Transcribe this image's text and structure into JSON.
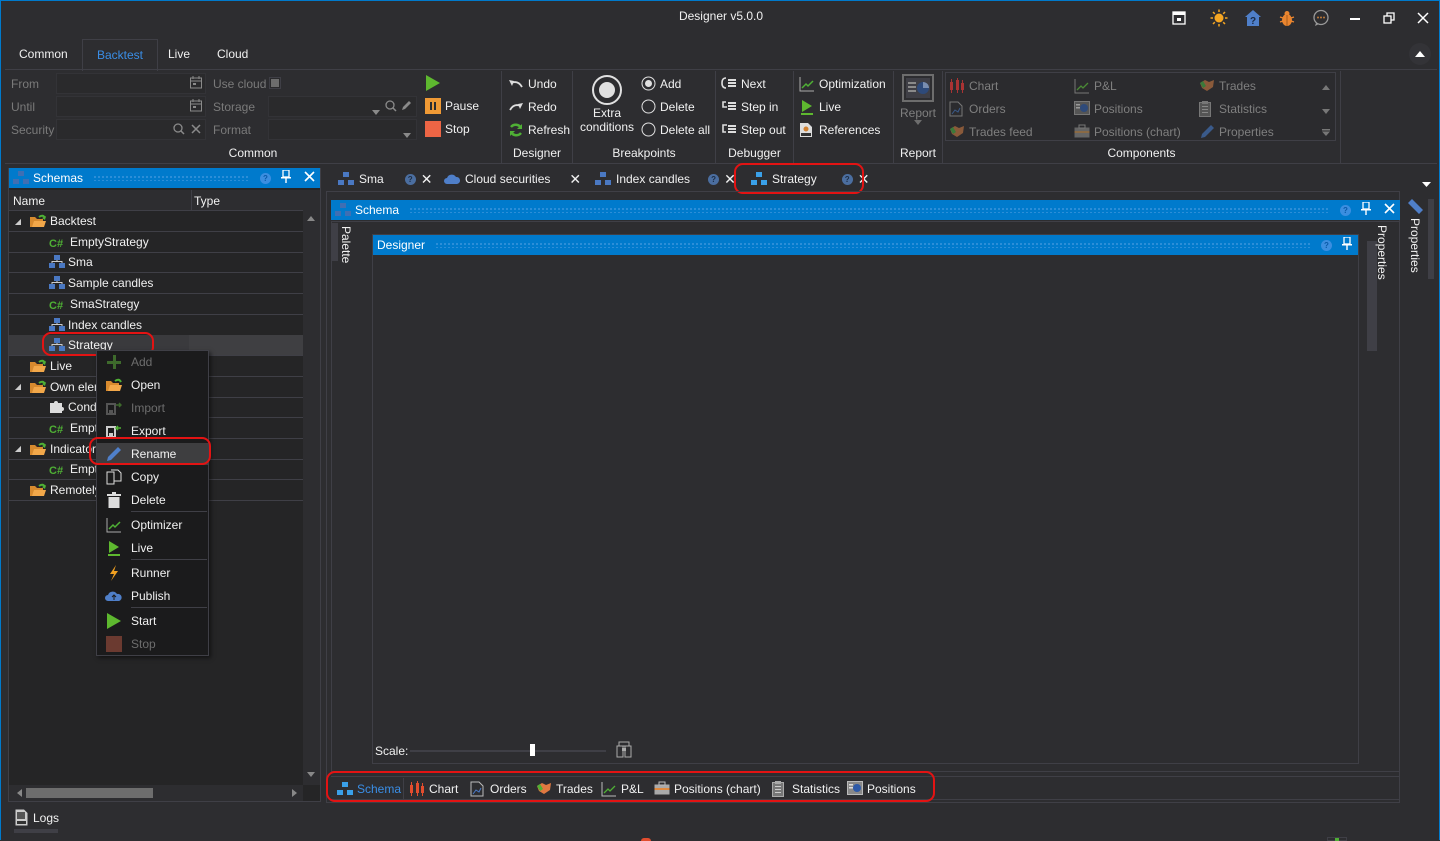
{
  "window": {
    "title": "Designer v5.0.0",
    "title_icons": [
      "layout-icon",
      "theme-sun-icon",
      "help-home-icon",
      "bug-report-icon",
      "chat-icon"
    ],
    "controls": [
      "minimize",
      "restore",
      "close"
    ]
  },
  "ribbon": {
    "tabs": [
      {
        "label": "Common",
        "active": false
      },
      {
        "label": "Backtest",
        "active": true
      },
      {
        "label": "Live",
        "active": false
      },
      {
        "label": "Cloud",
        "active": false
      }
    ],
    "common_group": {
      "name": "Common",
      "from_label": "From",
      "from_value": "",
      "until_label": "Until",
      "until_value": "",
      "security_label": "Security",
      "security_value": "",
      "use_cloud_label": "Use cloud",
      "storage_label": "Storage",
      "storage_value": "",
      "format_label": "Format",
      "format_value": "",
      "start_label": "",
      "pause_label": "Pause",
      "stop_label": "Stop"
    },
    "designer_group": {
      "name": "Designer",
      "undo": "Undo",
      "redo": "Redo",
      "refresh": "Refresh"
    },
    "breakpoints_group": {
      "name": "Breakpoints",
      "extra_conditions": "Extra conditions",
      "add": "Add",
      "delete": "Delete",
      "delete_all": "Delete all"
    },
    "debugger_group": {
      "name": "Debugger",
      "next": "Next",
      "step_in": "Step in",
      "step_out": "Step out"
    },
    "misc_group": {
      "optimization": "Optimization",
      "live": "Live",
      "references": "References"
    },
    "report_group": {
      "name": "Report",
      "report": "Report"
    },
    "components_group": {
      "name": "Components",
      "items": [
        "Chart",
        "P&L",
        "Trades",
        "Orders",
        "Positions",
        "Statistics",
        "Trades feed",
        "Positions (chart)",
        "Properties"
      ]
    }
  },
  "schemas_panel": {
    "title": "Schemas",
    "columns": [
      "Name",
      "Type"
    ],
    "tree": [
      {
        "label": "Backtest",
        "kind": "folder",
        "level": 0,
        "expanded": true
      },
      {
        "label": "EmptyStrategy",
        "kind": "csharp",
        "level": 1
      },
      {
        "label": "Sma",
        "kind": "schema",
        "level": 1
      },
      {
        "label": "Sample candles",
        "kind": "schema",
        "level": 1
      },
      {
        "label": "SmaStrategy",
        "kind": "csharp",
        "level": 1
      },
      {
        "label": "Index candles",
        "kind": "schema",
        "level": 1
      },
      {
        "label": "Strategy",
        "kind": "schema",
        "level": 1,
        "selected": true
      },
      {
        "label": "Live",
        "kind": "folder",
        "level": 0,
        "expanded": false
      },
      {
        "label": "Own elements",
        "kind": "folder",
        "level": 0,
        "expanded": true
      },
      {
        "label": "Conditions",
        "kind": "puzzle",
        "level": 1
      },
      {
        "label": "Empty",
        "kind": "csharp",
        "level": 1
      },
      {
        "label": "Indicators",
        "kind": "folder",
        "level": 0,
        "expanded": true
      },
      {
        "label": "Empty",
        "kind": "csharp",
        "level": 1
      },
      {
        "label": "Remotely",
        "kind": "folder",
        "level": 0,
        "expanded": false
      }
    ]
  },
  "context_menu": {
    "items": [
      {
        "label": "Add",
        "icon": "plus-icon",
        "disabled": true
      },
      {
        "label": "Open",
        "icon": "folder-open-icon",
        "disabled": false
      },
      {
        "label": "Import",
        "icon": "import-icon",
        "disabled": true
      },
      {
        "label": "Export",
        "icon": "export-icon",
        "disabled": false
      },
      {
        "label": "Rename",
        "icon": "pencil-icon",
        "disabled": false,
        "highlighted": true
      },
      {
        "label": "Copy",
        "icon": "copy-icon",
        "disabled": false
      },
      {
        "label": "Delete",
        "icon": "trash-icon",
        "disabled": false
      },
      {
        "label": "Optimizer",
        "icon": "optimizer-icon",
        "disabled": false
      },
      {
        "label": "Live",
        "icon": "live-icon",
        "disabled": false
      },
      {
        "label": "Runner",
        "icon": "lightning-icon",
        "disabled": false
      },
      {
        "label": "Publish",
        "icon": "cloud-upload-icon",
        "disabled": false
      },
      {
        "label": "Start",
        "icon": "play-icon",
        "disabled": false
      },
      {
        "label": "Stop",
        "icon": "stop-icon",
        "disabled": true
      }
    ]
  },
  "document_tabs": [
    {
      "label": "Sma",
      "icon": "schema-icon",
      "help": true,
      "active": false
    },
    {
      "label": "Cloud securities",
      "icon": "cloud-icon",
      "help": false,
      "active": false
    },
    {
      "label": "Index candles",
      "icon": "schema-icon",
      "help": true,
      "active": false
    },
    {
      "label": "Strategy",
      "icon": "schema-icon",
      "help": true,
      "active": true
    }
  ],
  "schema_panel": {
    "title": "Schema",
    "palette_label": "Palette",
    "properties_label": "Properties",
    "designer_title": "Designer",
    "scale_label": "Scale:",
    "scale_value": 0.62
  },
  "side_properties_label": "Properties",
  "bottom_tabs": [
    {
      "label": "Schema",
      "icon": "schema-icon",
      "active": true
    },
    {
      "label": "Chart",
      "icon": "candles-icon",
      "active": false
    },
    {
      "label": "Orders",
      "icon": "orders-icon",
      "active": false
    },
    {
      "label": "Trades",
      "icon": "handshake-icon",
      "active": false
    },
    {
      "label": "P&L",
      "icon": "pnl-icon",
      "active": false
    },
    {
      "label": "Positions (chart)",
      "icon": "briefcase-icon",
      "active": false
    },
    {
      "label": "Statistics",
      "icon": "clipboard-icon",
      "active": false
    },
    {
      "label": "Positions",
      "icon": "positions-icon",
      "active": false
    }
  ],
  "logs_label": "Logs",
  "colors": {
    "accent": "#007acc",
    "background": "#2d2d30",
    "panel": "#252526",
    "highlight_red": "#e31313",
    "active_tab_text": "#3a8ee6"
  }
}
